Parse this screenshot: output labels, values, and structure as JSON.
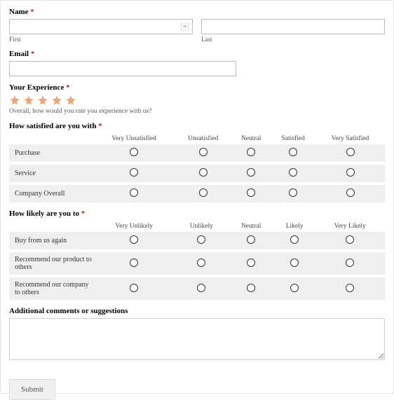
{
  "name": {
    "label": "Name",
    "first_sub": "First",
    "last_sub": "Last"
  },
  "email": {
    "label": "Email"
  },
  "experience": {
    "label": "Your Experience",
    "desc": "Overall, how would you rate you experience with us?"
  },
  "satisfaction": {
    "label": "How satisfied are you with",
    "headers": [
      "Very Unsatisfied",
      "Unsatisfied",
      "Neutral",
      "Satisfied",
      "Very Satisfied"
    ],
    "rows": [
      "Purchase",
      "Service",
      "Company Overall"
    ]
  },
  "likelihood": {
    "label": "How likely are you to",
    "headers": [
      "Very Unlikely",
      "Unlikely",
      "Neutral",
      "Likely",
      "Very Likely"
    ],
    "rows": [
      "Buy from us again",
      "Recommend our product to others",
      "Recommend our company to others"
    ]
  },
  "comments": {
    "label": "Additional comments or suggestions"
  },
  "submit": {
    "label": "Submit"
  },
  "required_marker": "*"
}
